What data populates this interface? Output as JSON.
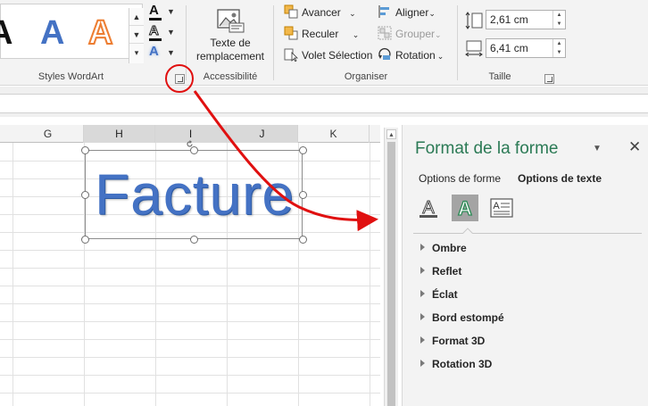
{
  "ribbon": {
    "wordart_group": {
      "label": "Styles WordArt",
      "preview_letter": "A"
    },
    "accessibility_group": {
      "label": "Accessibilité",
      "alt_text_button": "Texte de remplacement"
    },
    "organize_group": {
      "label": "Organiser",
      "bring_forward": "Avancer",
      "send_backward": "Reculer",
      "selection_pane": "Volet Sélection",
      "align": "Aligner",
      "group": "Grouper",
      "rotate": "Rotation"
    },
    "size_group": {
      "label": "Taille",
      "height": "2,61 cm",
      "width": "6,41 cm"
    }
  },
  "sheet": {
    "columns": [
      "G",
      "H",
      "I",
      "J",
      "K"
    ],
    "selected_columns": [
      "H",
      "I",
      "J"
    ],
    "wordart_text": "Facture"
  },
  "pane": {
    "title": "Format de la forme",
    "tabs": [
      "Options de forme",
      "Options de texte"
    ],
    "active_tab": "Options de texte",
    "sections": [
      "Ombre",
      "Reflet",
      "Éclat",
      "Bord estompé",
      "Format 3D",
      "Rotation 3D"
    ]
  },
  "colors": {
    "wordart_blue": "#4472c4",
    "wordart_orange": "#ed7d31",
    "pane_title_green": "#2b7a55",
    "annotation_red": "#e01010",
    "active_icon_green": "#2e8b57"
  },
  "icons": {
    "text_fill": "text-fill-icon",
    "text_outline": "text-outline-icon",
    "text_effects": "text-effects-icon",
    "alt_text": "alt-text-icon",
    "dialog_launcher": "dialog-launcher-icon",
    "close": "close-icon"
  }
}
